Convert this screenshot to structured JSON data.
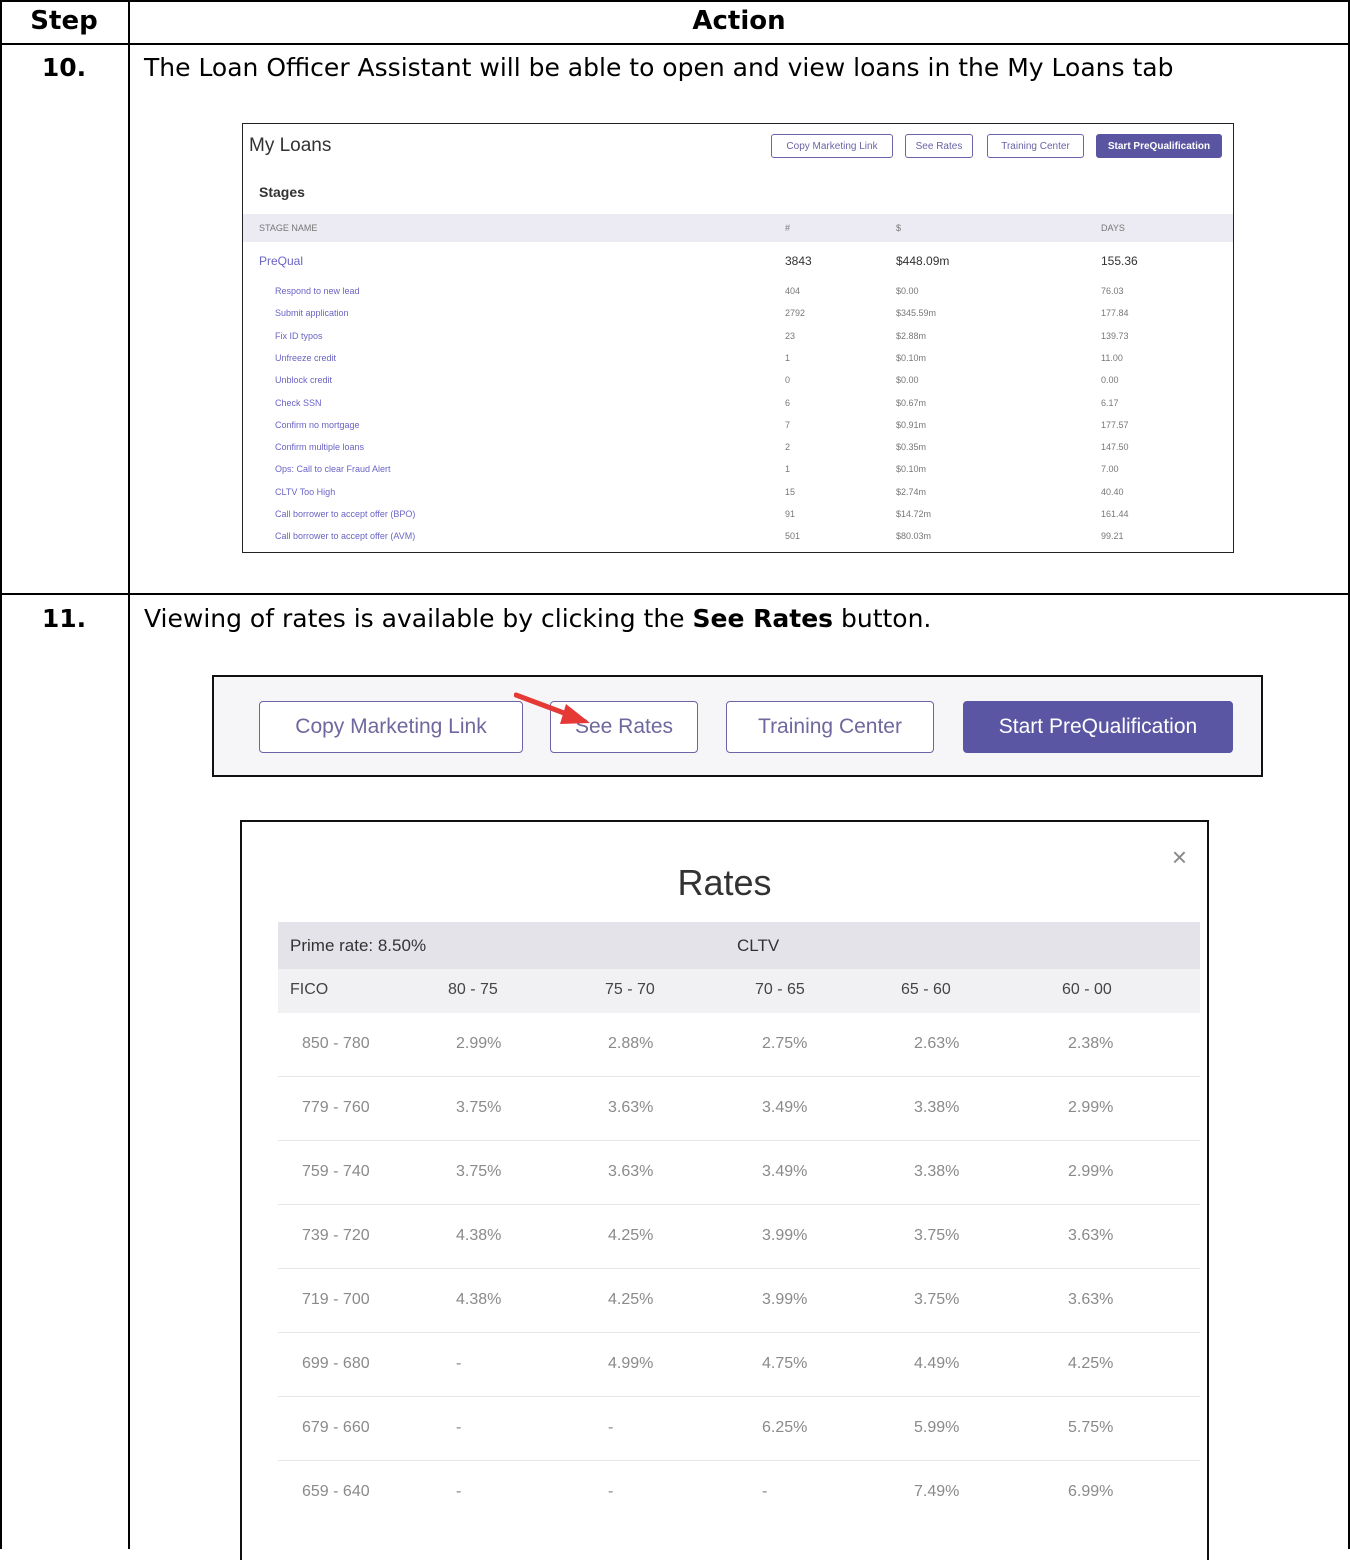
{
  "header": {
    "step": "Step",
    "action": "Action"
  },
  "steps": [
    {
      "num": "10.",
      "text": "The Loan Officer Assistant will be able to open and view loans in the My Loans tab"
    },
    {
      "num": "11.",
      "text_before": "Viewing of rates is available by clicking the ",
      "text_bold": "See Rates",
      "text_after": " button."
    }
  ],
  "my_loans": {
    "title": "My Loans",
    "buttons": [
      "Copy Marketing Link",
      "See Rates",
      "Training Center",
      "Start PreQualification"
    ],
    "stages_label": "Stages",
    "columns": [
      "STAGE NAME",
      "#",
      "$",
      "DAYS"
    ],
    "group": {
      "name": "PreQual",
      "count": "3843",
      "amount": "$448.09m",
      "days": "155.36"
    },
    "rows": [
      {
        "name": "Respond to new lead",
        "count": "404",
        "amount": "$0.00",
        "days": "76.03"
      },
      {
        "name": "Submit application",
        "count": "2792",
        "amount": "$345.59m",
        "days": "177.84"
      },
      {
        "name": "Fix ID typos",
        "count": "23",
        "amount": "$2.88m",
        "days": "139.73"
      },
      {
        "name": "Unfreeze credit",
        "count": "1",
        "amount": "$0.10m",
        "days": "11.00"
      },
      {
        "name": "Unblock credit",
        "count": "0",
        "amount": "$0.00",
        "days": "0.00"
      },
      {
        "name": "Check SSN",
        "count": "6",
        "amount": "$0.67m",
        "days": "6.17"
      },
      {
        "name": "Confirm no mortgage",
        "count": "7",
        "amount": "$0.91m",
        "days": "177.57"
      },
      {
        "name": "Confirm multiple loans",
        "count": "2",
        "amount": "$0.35m",
        "days": "147.50"
      },
      {
        "name": "Ops: Call to clear Fraud Alert",
        "count": "1",
        "amount": "$0.10m",
        "days": "7.00"
      },
      {
        "name": "CLTV Too High",
        "count": "15",
        "amount": "$2.74m",
        "days": "40.40"
      },
      {
        "name": "Call borrower to accept offer (BPO)",
        "count": "91",
        "amount": "$14.72m",
        "days": "161.44"
      },
      {
        "name": "Call borrower to accept offer (AVM)",
        "count": "501",
        "amount": "$80.03m",
        "days": "99.21"
      }
    ]
  },
  "toolbar": {
    "buttons": [
      "Copy Marketing Link",
      "See Rates",
      "Training Center",
      "Start PreQualification"
    ],
    "accent": "#5b56a3",
    "arrow_color": "#e53935"
  },
  "rates": {
    "title": "Rates",
    "close_icon": "close-icon",
    "prime_rate": "Prime rate: 8.50%",
    "cltv_label": "CLTV",
    "columns": [
      "FICO",
      "80 - 75",
      "75 - 70",
      "70 - 65",
      "65 - 60",
      "60 - 00"
    ],
    "rows": [
      [
        "850 - 780",
        "2.99%",
        "2.88%",
        "2.75%",
        "2.63%",
        "2.38%"
      ],
      [
        "779 - 760",
        "3.75%",
        "3.63%",
        "3.49%",
        "3.38%",
        "2.99%"
      ],
      [
        "759 - 740",
        "3.75%",
        "3.63%",
        "3.49%",
        "3.38%",
        "2.99%"
      ],
      [
        "739 - 720",
        "4.38%",
        "4.25%",
        "3.99%",
        "3.75%",
        "3.63%"
      ],
      [
        "719 - 700",
        "4.38%",
        "4.25%",
        "3.99%",
        "3.75%",
        "3.63%"
      ],
      [
        "699 - 680",
        "-",
        "4.99%",
        "4.75%",
        "4.49%",
        "4.25%"
      ],
      [
        "679 - 660",
        "-",
        "-",
        "6.25%",
        "5.99%",
        "5.75%"
      ],
      [
        "659 - 640",
        "-",
        "-",
        "-",
        "7.49%",
        "6.99%"
      ]
    ]
  }
}
